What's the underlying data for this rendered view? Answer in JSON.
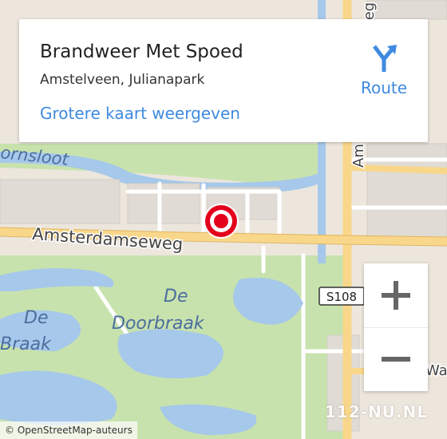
{
  "popup": {
    "title": "Brandweer Met Spoed",
    "subtitle": "Amstelveen, Julianapark",
    "larger_map_link": "Grotere kaart weergeven",
    "route_label": "Route"
  },
  "map": {
    "labels": {
      "water_top": "ornsloot",
      "road_main": "Amsterdamseweg",
      "park_1": "De",
      "park_2": "Doorbraak",
      "water_left_1": "De",
      "water_left_2": "Braak",
      "road_shield": "S108",
      "road_right_vertical": "Am",
      "road_right_bottom": "Wa",
      "road_top_right": "weg"
    },
    "colors": {
      "land": "#ece6dd",
      "park": "#c8e2ad",
      "water": "#a6c8ea",
      "road_major": "#f9d78a",
      "road_minor": "#ffffff",
      "marker": "#e3001b"
    }
  },
  "zoom": {
    "in_symbol": "+",
    "out_symbol": "−"
  },
  "attribution": "© OpenStreetMap-auteurs",
  "watermark": "112-NU.NL"
}
